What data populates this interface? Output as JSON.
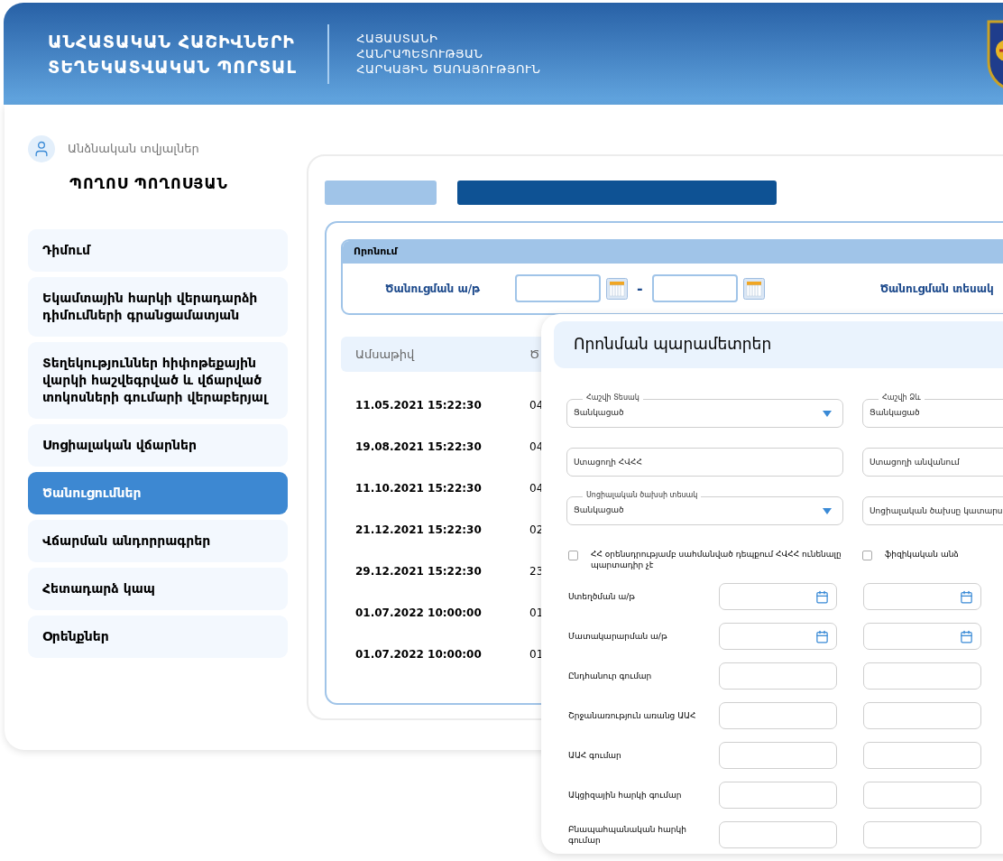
{
  "header": {
    "title_lines": [
      "ԱՆՀԱՏԱԿԱՆ ՀԱՇԻՎՆԵՐԻ",
      "ՏԵՂԵԿԱՏՎԱԿԱՆ ՊՈՐՏԱԼ"
    ],
    "subtitle_lines": [
      "ՀԱՅԱՍՏԱՆԻ",
      "ՀԱՆՐԱՊԵՏՈՒԹՅԱՆ",
      "ՀԱՐԿԱՅԻՆ ԾԱՌԱՅՈՒԹՅՈՒՆ"
    ]
  },
  "profile": {
    "caption": "Անձնական տվյալներ",
    "name": "ՊՈՂՈՍ ՊՈՂՈՍՅԱՆ"
  },
  "sidebar": {
    "items": [
      {
        "label": "Դիմում",
        "selected": false
      },
      {
        "label": "Եկամտային հարկի վերադարձի դիմումների գրանցամատյան",
        "selected": false
      },
      {
        "label": "Տեղեկություններ հիփոթեքային վարկի հաշվեգրված և վճարված տոկոսների գումարի վերաբերյալ",
        "selected": false
      },
      {
        "label": "Սոցիալական վճարներ",
        "selected": false
      },
      {
        "label": "Ծանուցումներ",
        "selected": true
      },
      {
        "label": "Վճարման անդորրագրեր",
        "selected": false
      },
      {
        "label": "Հետադարձ կապ",
        "selected": false
      },
      {
        "label": "Օրենքներ",
        "selected": false
      }
    ]
  },
  "search": {
    "title": "Որոնում",
    "date_label": "Ծանուցման ա/թ",
    "separator": "-",
    "type_label": "Ծանուցման տեսակ"
  },
  "table": {
    "columns": [
      "Ամսաթիվ",
      "Ծ"
    ],
    "rows": [
      [
        "11.05.2021 15:22:30",
        "04"
      ],
      [
        "19.08.2021 15:22:30",
        "04"
      ],
      [
        "11.10.2021 15:22:30",
        "04"
      ],
      [
        "21.12.2021 15:22:30",
        "02"
      ],
      [
        "29.12.2021 15:22:30",
        "23"
      ],
      [
        "01.07.2022 10:00:00",
        "01"
      ],
      [
        "01.07.2022 10:00:00",
        "01"
      ]
    ]
  },
  "params": {
    "title": "Որոնման պարամետրեր",
    "fields": [
      {
        "kind": "select",
        "label": "Հաշվի Տեսակ",
        "value": "Ցանկացած"
      },
      {
        "kind": "select",
        "label": "Հաշվի Ձև",
        "value": "Ցանկացած"
      },
      {
        "kind": "text",
        "placeholder": "Ստացողի ՀՎՀՀ"
      },
      {
        "kind": "text",
        "placeholder": "Ստացողի անվանում"
      },
      {
        "kind": "select",
        "label": "Սոցիալական ծախսի տեսակ",
        "value": "Ցանկացած"
      },
      {
        "kind": "text",
        "placeholder": "Սոցիալական ծախսը կատարս"
      }
    ],
    "checkboxes": [
      {
        "label": "ՀՀ օրենսդրությամբ սահմանված դեպքում ՀՎՀՀ ունենալը պարտադիր չէ",
        "checked": false
      },
      {
        "label": "ֆիզիկական անձ",
        "checked": false
      }
    ],
    "ranges": [
      {
        "kind": "date",
        "label": "Ստեղծման ա/թ"
      },
      {
        "kind": "date",
        "label": "Մատակարարման ա/թ"
      },
      {
        "kind": "amount",
        "label": "Ընդհանուր գումար"
      },
      {
        "kind": "amount",
        "label": "Շրջանառություն առանց ԱԱՀ"
      },
      {
        "kind": "amount",
        "label": "ԱԱՀ գումար"
      },
      {
        "kind": "amount",
        "label": "Ակցիզային հարկի գումար"
      },
      {
        "kind": "amount",
        "label": "Բնապահպանական հարկի գումար"
      }
    ]
  }
}
